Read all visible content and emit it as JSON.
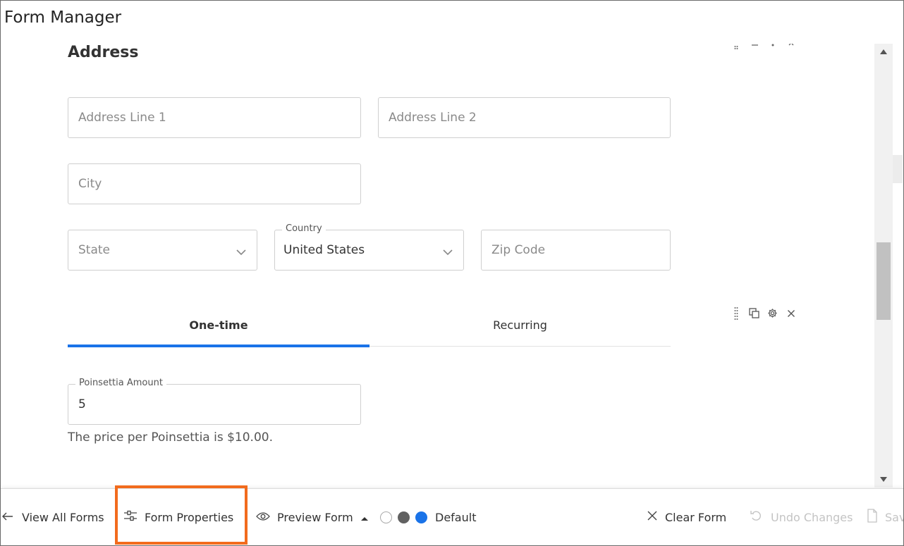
{
  "app": {
    "title": "Form Manager"
  },
  "form": {
    "section_title": "Address",
    "address_line1": {
      "placeholder": "Address Line 1"
    },
    "address_line2": {
      "placeholder": "Address Line 2"
    },
    "city": {
      "placeholder": "City"
    },
    "state": {
      "placeholder": "State",
      "icon": "chevron-down-icon"
    },
    "country": {
      "label": "Country",
      "value": "United States",
      "icon": "chevron-down-icon"
    },
    "zip": {
      "placeholder": "Zip Code"
    },
    "tabs": [
      {
        "label": "One-time",
        "active": true
      },
      {
        "label": "Recurring",
        "active": false
      }
    ],
    "amount": {
      "label": "Poinsettia Amount",
      "value": "5"
    },
    "help_text": "The price per Poinsettia is $10.00.",
    "block_controls": [
      "drag-handle-icon",
      "duplicate-icon",
      "gear-icon",
      "close-icon"
    ]
  },
  "bottom_bar": {
    "view_all": {
      "label": "View All Forms",
      "icon": "arrow-left-icon"
    },
    "form_properties": {
      "label": "Form Properties",
      "icon": "sliders-icon"
    },
    "preview": {
      "label": "Preview Form",
      "icon": "eye-icon"
    },
    "theme": {
      "label": "Default",
      "swatches": [
        "#ffffff",
        "#616161",
        "#1a73e8"
      ]
    },
    "clear": {
      "label": "Clear Form",
      "icon": "close-icon"
    },
    "undo": {
      "label": "Undo Changes",
      "icon": "undo-icon"
    },
    "save": {
      "label": "Sav",
      "icon": "document-icon"
    }
  },
  "colors": {
    "accent": "#1a73e8",
    "highlight": "#f26b1d"
  }
}
